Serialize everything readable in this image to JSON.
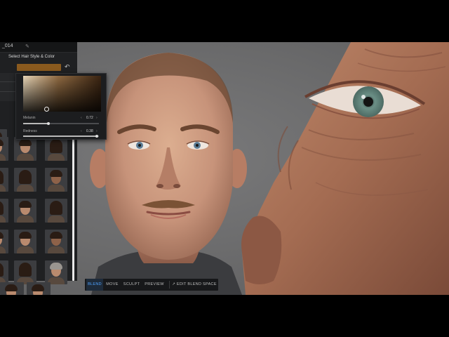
{
  "panel": {
    "file_name": "_014",
    "section_title": "Select Hair Style & Color",
    "swatch_color": "#8a5a1e",
    "icons": {
      "edit": "pencil-icon",
      "reset": "undo-icon"
    }
  },
  "color_picker": {
    "melanin": {
      "label": "Melanin",
      "value": "0.72",
      "level": 0.33
    },
    "redness": {
      "label": "Redness",
      "value": "0.38",
      "level": 0.97
    }
  },
  "toolbar": {
    "blend_label": "BLEND",
    "move_label": "MOVE",
    "sculpt_label": "SCULPT",
    "preview_label": "PREVIEW",
    "edit_blend_space_label": "↗ EDIT BLEND SPACE",
    "active_color": "#4fa3ff"
  },
  "hair_thumbnails": {
    "count": 24,
    "columns": 3
  }
}
